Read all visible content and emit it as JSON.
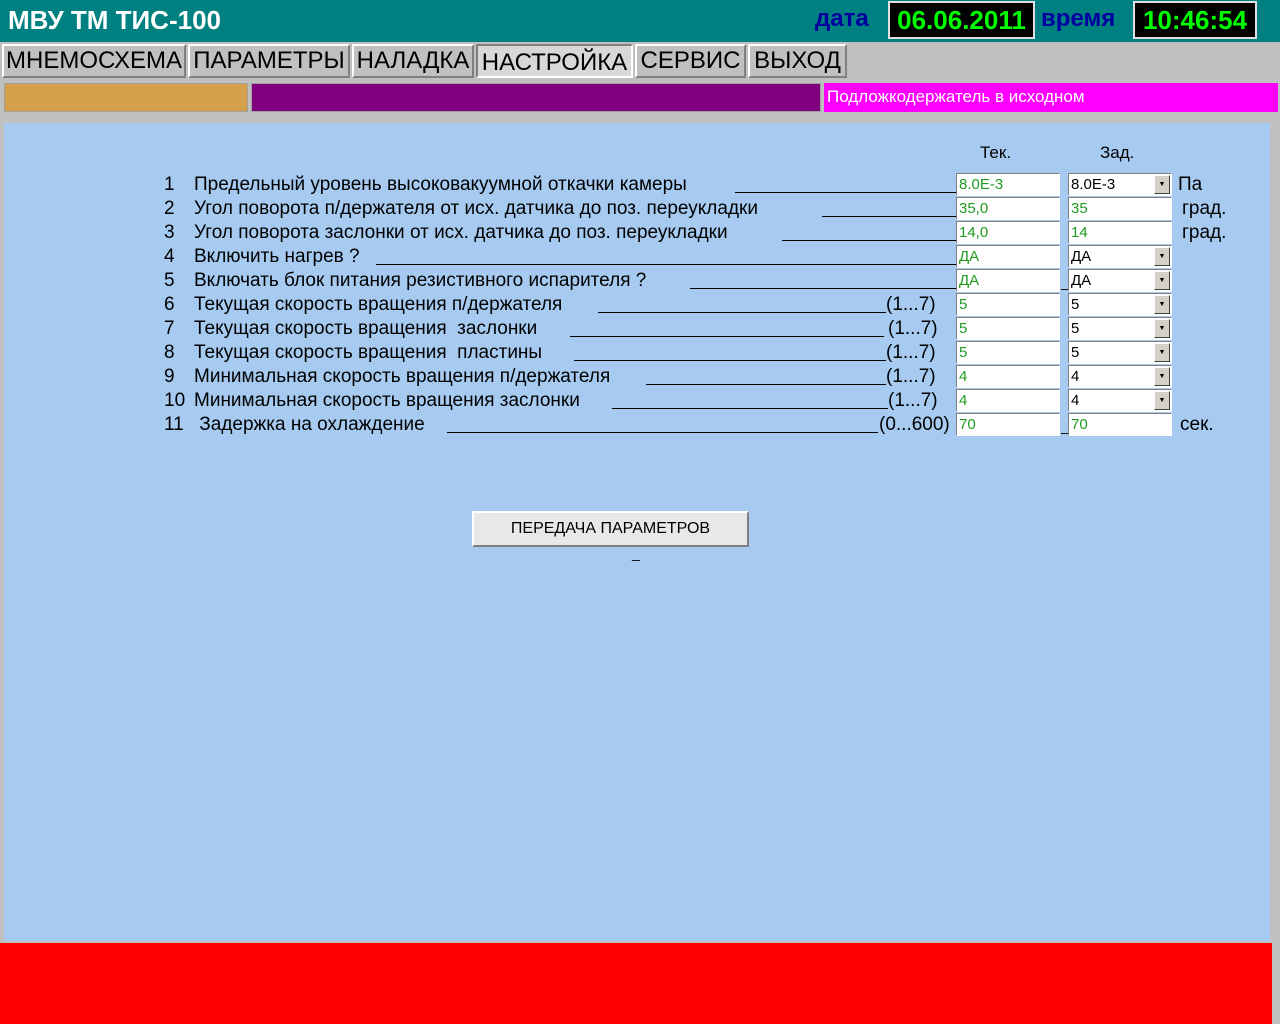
{
  "header": {
    "title": "МВУ ТМ ТИС-100",
    "date_label": "дата",
    "date_value": "06.06.2011",
    "time_label": "время",
    "time_value": "10:46:54"
  },
  "menu": [
    {
      "label": "МНЕМОСХЕМА"
    },
    {
      "label": "ПАРАМЕТРЫ"
    },
    {
      "label": "НАЛАДКА"
    },
    {
      "label": "НАСТРОЙКА",
      "active": true
    },
    {
      "label": "СЕРВИС"
    },
    {
      "label": "ВЫХОД"
    }
  ],
  "status": {
    "message": "Подложкодержатель в исходном",
    "colors": {
      "indicator_1": "#d4a04a",
      "indicator_2": "#800080",
      "message_bg": "#ff00ff",
      "alarm": "#ff0000"
    }
  },
  "columns": {
    "current": "Тек.",
    "setpoint": "Зад."
  },
  "rows": [
    {
      "num": "1",
      "label": "Предельный уровень высоковакуумной откачки камеры",
      "range": "",
      "current": "8.0E-3",
      "setpoint": "8.0E-3",
      "dropdown": true,
      "unit": "Па"
    },
    {
      "num": "2",
      "label": "Угол поворота п/держателя от исх. датчика до поз. переукладки",
      "range": "",
      "current": "35,0",
      "setpoint": "35",
      "dropdown": false,
      "unit": "град."
    },
    {
      "num": "3",
      "label": "Угол поворота заслонки от исх. датчика до поз. переукладки",
      "range": "",
      "current": "14,0",
      "setpoint": "14",
      "dropdown": false,
      "unit": "град."
    },
    {
      "num": "4",
      "label": "Включить нагрев ?",
      "range": "",
      "current": "ДА",
      "setpoint": "ДА",
      "dropdown": true,
      "unit": ""
    },
    {
      "num": "5",
      "label": "Включать блок питания резистивного испарителя ?",
      "range": "",
      "current": "ДА",
      "setpoint": "ДА",
      "dropdown": true,
      "unit": ""
    },
    {
      "num": "6",
      "label": "Текущая скорость вращения п/держателя",
      "range": "(1...7)",
      "current": "5",
      "setpoint": "5",
      "dropdown": true,
      "unit": ""
    },
    {
      "num": "7",
      "label": "Текущая скорость вращения  заслонки",
      "range": "(1...7)",
      "current": "5",
      "setpoint": "5",
      "dropdown": true,
      "unit": ""
    },
    {
      "num": "8",
      "label": "Текущая скорость вращения  пластины",
      "range": "(1...7)",
      "current": "5",
      "setpoint": "5",
      "dropdown": true,
      "unit": ""
    },
    {
      "num": "9",
      "label": "Минимальная скорость вращения п/держателя",
      "range": "(1...7)",
      "current": "4",
      "setpoint": "4",
      "dropdown": true,
      "unit": ""
    },
    {
      "num": "10",
      "label": "Минимальная скорость вращения заслонки",
      "range": "(1...7)",
      "current": "4",
      "setpoint": "4",
      "dropdown": true,
      "unit": ""
    },
    {
      "num": "11",
      "label": " Задержка на охлаждение",
      "range": "(0...600)",
      "current": "70",
      "setpoint": "70",
      "dropdown": false,
      "unit": "сек."
    }
  ],
  "actions": {
    "send_label": "ПЕРЕДАЧА ПАРАМЕТРОВ"
  }
}
